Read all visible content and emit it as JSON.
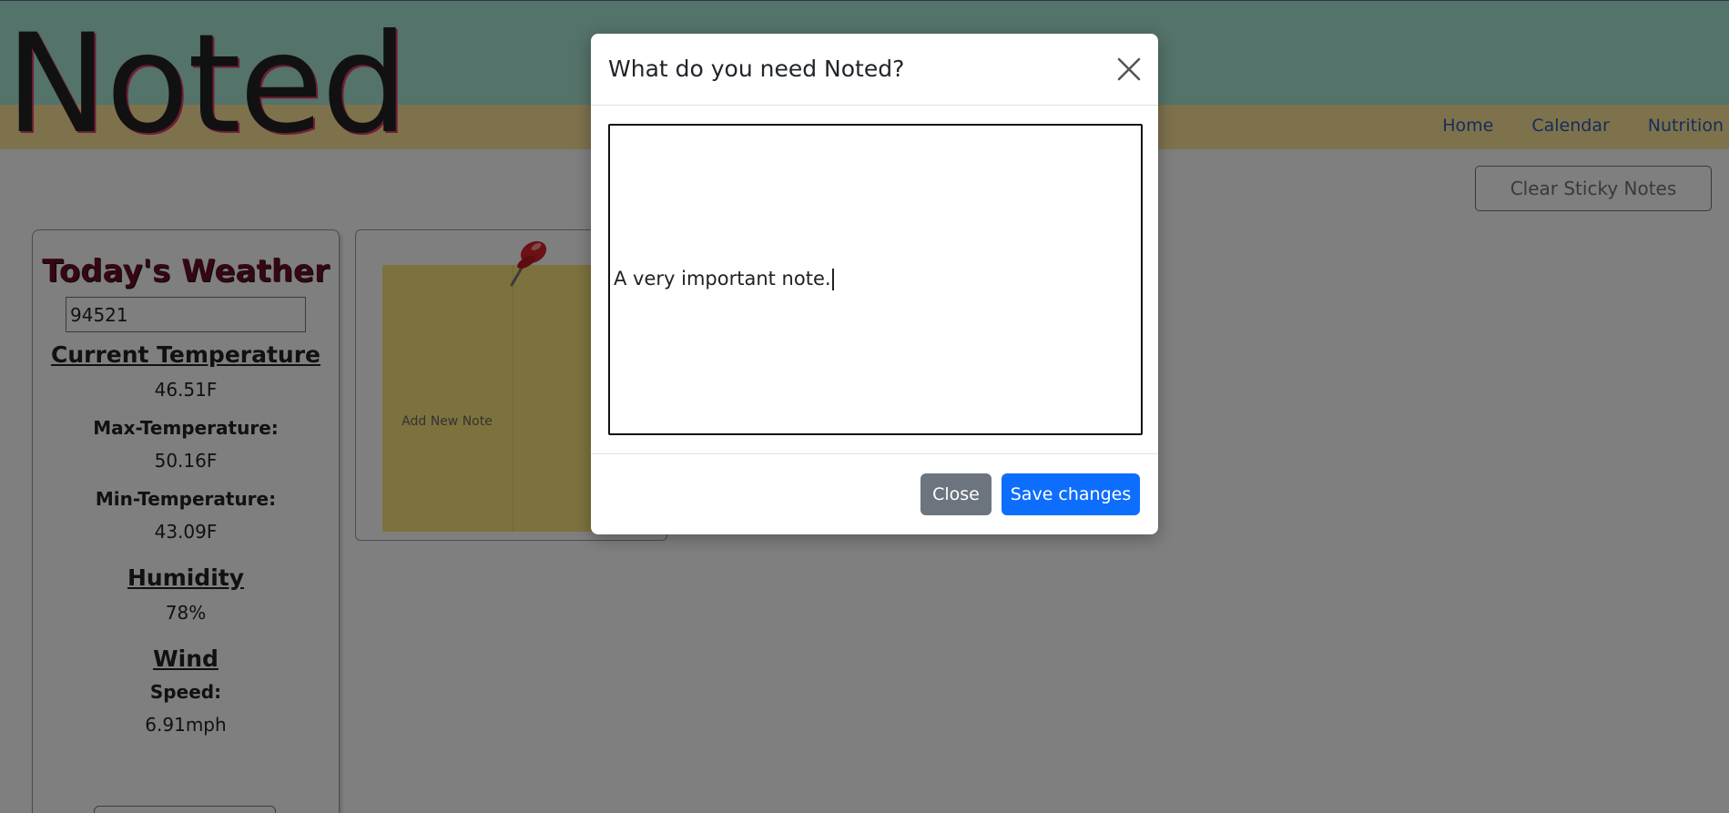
{
  "app": {
    "title": "Noted"
  },
  "nav": {
    "items": [
      "Home",
      "Calendar",
      "Nutrition"
    ]
  },
  "toolbar": {
    "clear_label": "Clear Sticky Notes"
  },
  "weather": {
    "title": "Today's Weather",
    "zip_value": "94521",
    "current_heading": "Current Temperature",
    "current_value": "46.51F",
    "max_label": "Max-Temperature:",
    "max_value": "50.16F",
    "min_label": "Min-Temperature:",
    "min_value": "43.09F",
    "humidity_heading": "Humidity",
    "humidity_value": "78%",
    "wind_heading": "Wind",
    "speed_label": "Speed:",
    "speed_value": "6.91mph"
  },
  "notes": {
    "add_label": "Add New Note"
  },
  "modal": {
    "title": "What do you need Noted?",
    "note_text": "A very important note.",
    "close_label": "Close",
    "save_label": "Save changes"
  },
  "colors": {
    "header_top": "#a8e6d4",
    "header_nav": "#fde49a",
    "sticky": "#fbe47a",
    "primary": "#0d6efd",
    "secondary": "#6c757d"
  },
  "icons": {
    "close": "close-icon",
    "pin": "pushpin-icon"
  }
}
